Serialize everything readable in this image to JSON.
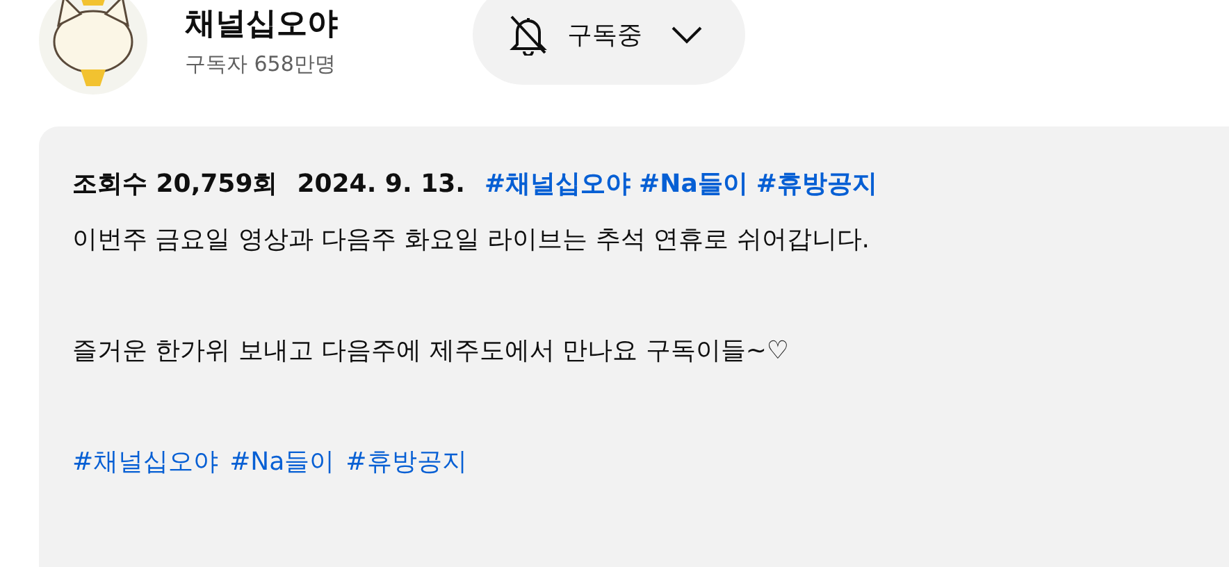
{
  "channel": {
    "name": "채널십오야",
    "subscribers": "구독자 658만명"
  },
  "subscribe_button": {
    "label": "구독중",
    "notifications_on": false
  },
  "description": {
    "views": "조회수 20,759회",
    "date": "2024. 9. 13.",
    "top_hashtags": [
      "#채널십오야",
      "#Na들이",
      "#휴방공지"
    ],
    "paragraphs": [
      "이번주 금요일 영상과 다음주 화요일 라이브는 추석 연휴로 쉬어갑니다.",
      "즐거운 한가위 보내고 다음주에 제주도에서 만나요 구독이들~♡"
    ],
    "bottom_hashtags": [
      "#채널십오야",
      "#Na들이",
      "#휴방공지"
    ]
  }
}
